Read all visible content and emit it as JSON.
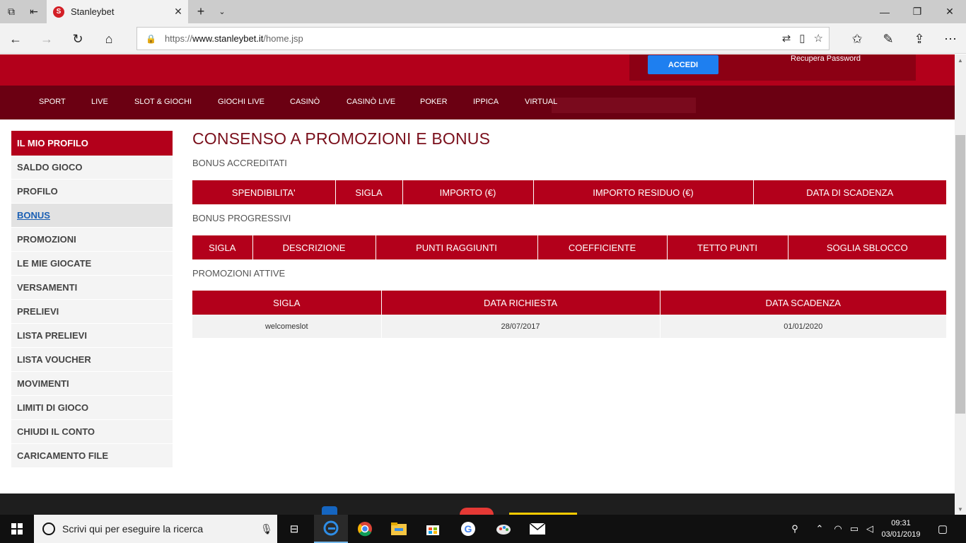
{
  "browser": {
    "tab_title": "Stanleybet",
    "tab_favicon_letter": "S",
    "url_prefix": "https://",
    "url_domain": "www.stanleybet.it",
    "url_path": "/home.jsp"
  },
  "site": {
    "login_button": "ACCEDI",
    "recover_password": "Recupera Password",
    "menu": [
      "SPORT",
      "LIVE",
      "SLOT & GIOCHI",
      "GIOCHI LIVE",
      "CASINÒ",
      "CASINÒ LIVE",
      "POKER",
      "IPPICA",
      "VIRTUAL"
    ]
  },
  "sidebar": {
    "header": "IL MIO PROFILO",
    "items": [
      "SALDO GIOCO",
      "PROFILO",
      "BONUS",
      "PROMOZIONI",
      "LE MIE GIOCATE",
      "VERSAMENTI",
      "PRELIEVI",
      "LISTA PRELIEVI",
      "LISTA VOUCHER",
      "MOVIMENTI",
      "LIMITI DI GIOCO",
      "CHIUDI IL CONTO",
      "CARICAMENTO FILE"
    ],
    "active_index": 2
  },
  "main": {
    "title": "CONSENSO A PROMOZIONI E BONUS",
    "bonus_accreditati": {
      "title": "BONUS ACCREDITATI",
      "headers": [
        "SPENDIBILITA'",
        "SIGLA",
        "IMPORTO (€)",
        "IMPORTO RESIDUO (€)",
        "DATA DI SCADENZA"
      ]
    },
    "bonus_progressivi": {
      "title": "BONUS PROGRESSIVI",
      "headers": [
        "SIGLA",
        "DESCRIZIONE",
        "PUNTI RAGGIUNTI",
        "COEFFICIENTE",
        "TETTO PUNTI",
        "SOGLIA SBLOCCO"
      ]
    },
    "promozioni_attive": {
      "title": "PROMOZIONI ATTIVE",
      "headers": [
        "SIGLA",
        "DATA RICHIESTA",
        "DATA SCADENZA"
      ],
      "rows": [
        [
          "welcomeslot",
          "28/07/2017",
          "01/01/2020"
        ]
      ]
    }
  },
  "taskbar": {
    "search_placeholder": "Scrivi qui per eseguire la ricerca",
    "time": "09:31",
    "date": "03/01/2019"
  },
  "colors": {
    "brand_red": "#b3001b",
    "menu_dark_red": "#6b0012",
    "title_red": "#7a0f1b",
    "login_blue": "#1e7ff0"
  }
}
